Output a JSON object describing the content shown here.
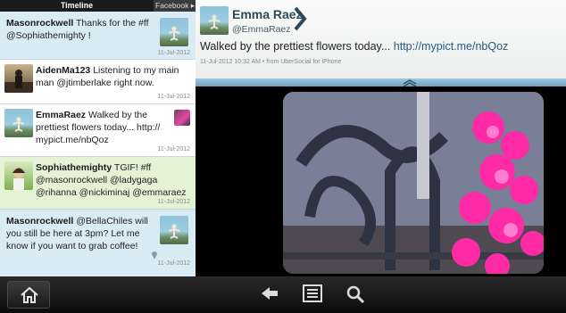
{
  "tabs": {
    "timeline": "Timeline",
    "facebook": "Facebook"
  },
  "timeline": [
    {
      "user": "Masonrockwell",
      "text": "Thanks for the #ff @Sophiathemighty !",
      "time": "11-Jul-2012"
    },
    {
      "user": "AidenMa123",
      "text": "Listening to my main man @jtimberlake right now.",
      "time": "11-Jul-2012"
    },
    {
      "user": "EmmaRaez",
      "text": "Walked by the prettiest flowers today... http:// mypict.me/nbQoz",
      "time": "11-Jul-2012"
    },
    {
      "user": "Sophiathemighty",
      "text": "TGIF! #ff @masonrockwell @ladygaga @rihanna @nickiminaj @emmaraez",
      "time": "11-Jul-2012"
    },
    {
      "user": "Masonrockwell",
      "text": "@BellaChiles will you still be here at 3pm? Let me know if you want to grab coffee!",
      "time": "11-Jul-2012"
    }
  ],
  "detail": {
    "name": "Emma Raez",
    "handle": "@EmmaRaez",
    "text": "Walked by the prettiest flowers today...",
    "link": "http://mypict.me/nbQoz",
    "meta": "11-Jul-2012 10:32 AM • from UberSocial for iPhone"
  },
  "colors": {
    "accent": "#2a4a5c",
    "divider": "#8cbbd4",
    "highlight": "#d9ecf6"
  },
  "nav": [
    "home-icon",
    "back-arrow-icon",
    "list-icon",
    "search-icon"
  ]
}
